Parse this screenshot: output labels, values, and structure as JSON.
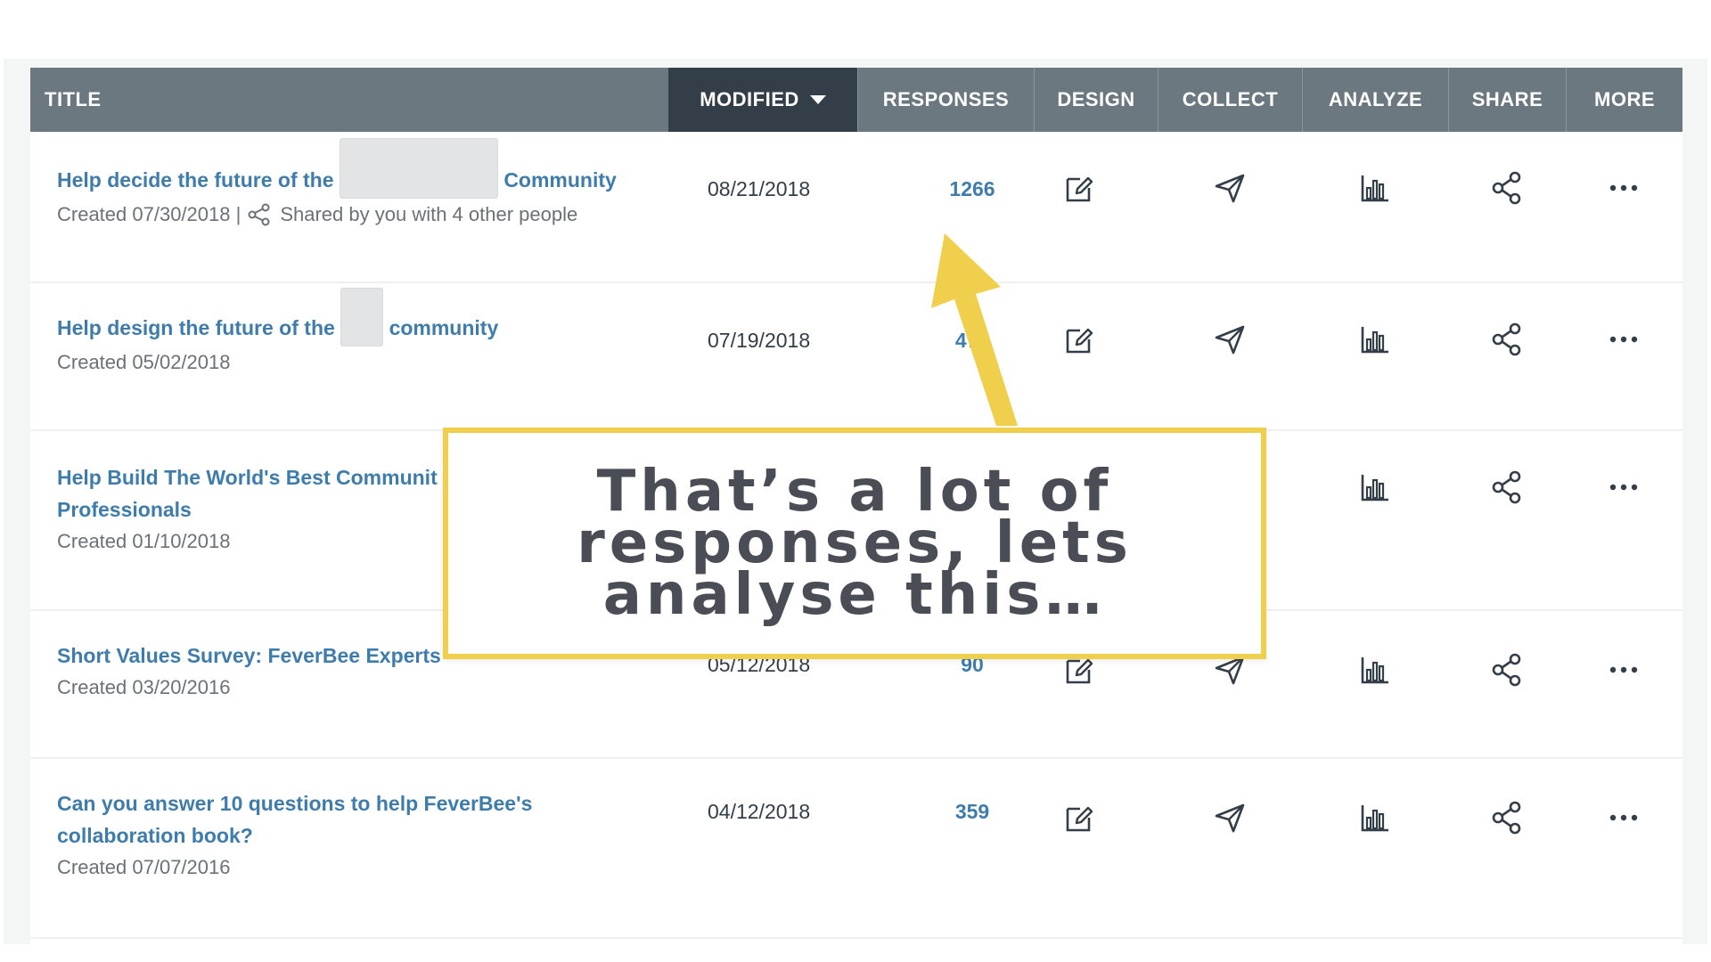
{
  "header": {
    "title": "TITLE",
    "modified": "MODIFIED",
    "responses": "RESPONSES",
    "design": "DESIGN",
    "collect": "COLLECT",
    "analyze": "ANALYZE",
    "share": "SHARE",
    "more": "MORE"
  },
  "rows": [
    {
      "title_a": "Help decide the future of the",
      "title_b": "Community",
      "created": "Created 07/30/2018 |",
      "shared": "Shared by you with 4 other people",
      "modified": "08/21/2018",
      "responses": "1266"
    },
    {
      "title_a": "Help design the future of the",
      "title_b": "community",
      "created": "Created 05/02/2018",
      "modified": "07/19/2018",
      "responses": "472"
    },
    {
      "title_line1": "Help Build The World's Best Communit",
      "title_line2": "Professionals",
      "created": "Created 01/10/2018"
    },
    {
      "title": "Short Values Survey: FeverBee Experts",
      "created": "Created 03/20/2016",
      "modified": "05/12/2018",
      "responses": "90"
    },
    {
      "title_line1": "Can you answer 10 questions to help FeverBee's",
      "title_line2": "collaboration book?",
      "created": "Created 07/07/2016",
      "modified": "04/12/2018",
      "responses": "359"
    }
  ],
  "icons": {
    "design": "edit-icon",
    "collect": "send-icon",
    "analyze": "bar-chart-icon",
    "share": "share-icon",
    "more": "more-icon"
  },
  "callout": {
    "line1": "That’s a lot of",
    "line2": "responses, lets",
    "line3": "analyse this…"
  },
  "colors": {
    "header_bg": "#6b787f",
    "header_active": "#333e48",
    "link": "#3e7cab",
    "callout_border": "#f0cf4c",
    "arrow": "#f0cf4c"
  }
}
